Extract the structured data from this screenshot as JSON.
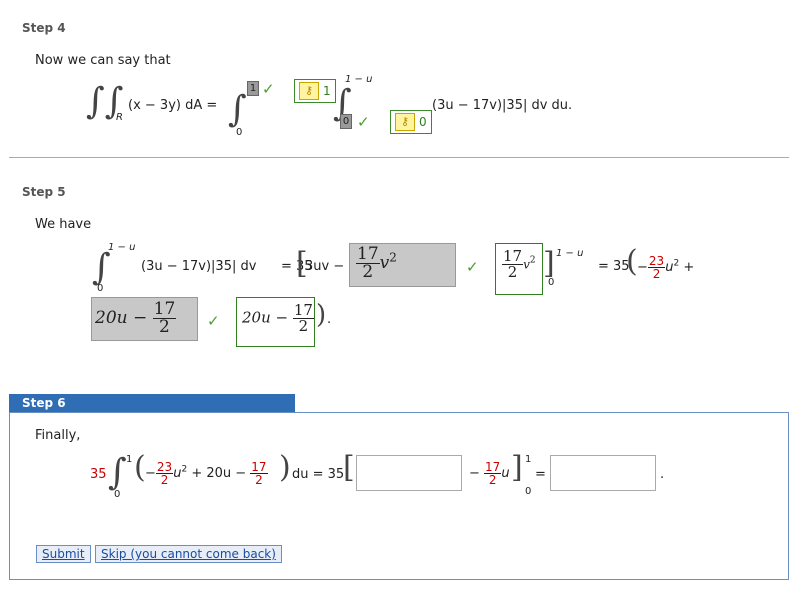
{
  "step4": {
    "header": "Step 4",
    "intro": "Now we can say that",
    "lhs": "(x − 3y) dA =",
    "region": "R",
    "outer_lower": "0",
    "outer_upper": "1",
    "outer_key": "1",
    "inner_upper": "1 − u",
    "inner_lower": "0",
    "inner_key": "0",
    "integrand": "(3u − 17v)|35| dv du."
  },
  "step5": {
    "header": "Step 5",
    "intro": "We have",
    "upper": "1 − u",
    "lower": "0",
    "integrand": "(3u − 17v)|35| dv",
    "eq1": "= 35",
    "term_3uv": "3uv −",
    "ans_num": "17",
    "ans_den": "2",
    "ans_var": "v",
    "ans_pow": "2",
    "key_num": "17",
    "key_den": "2",
    "key_var": "v",
    "key_pow": "2",
    "eval_upper": "1 − u",
    "eval_lower": "0",
    "eq2": "= 35",
    "neg": "−",
    "c_num": "23",
    "c_den": "2",
    "u2": "u",
    "u2pow": "2",
    "plus": "+",
    "row2_ans_coeff": "20u −",
    "row2_ans_num": "17",
    "row2_ans_den": "2",
    "row2_key_coeff": "20u −",
    "row2_key_num": "17",
    "row2_key_den": "2",
    "period": "."
  },
  "step6": {
    "header": "Step 6",
    "intro": "Finally,",
    "coef": "35",
    "upper": "1",
    "lower": "0",
    "neg": "−",
    "c_num": "23",
    "c_den": "2",
    "u2": "u",
    "u2pow": "2",
    "plus_20u": "+ 20u −",
    "d_num": "17",
    "d_den": "2",
    "du": "du = 35",
    "minus": "−",
    "e_num": "17",
    "e_den": "2",
    "e_var": "u",
    "eval_upper": "1",
    "eval_lower": "0",
    "eq": "=",
    "period": ".",
    "submit_label": "Submit",
    "skip_label": "Skip (you cannot come back)"
  },
  "colors": {
    "accent": "#2f6db5",
    "check": "#4a9d2f",
    "fraction_red": "#cc0000"
  },
  "icons": [
    "check-icon",
    "key-icon"
  ]
}
